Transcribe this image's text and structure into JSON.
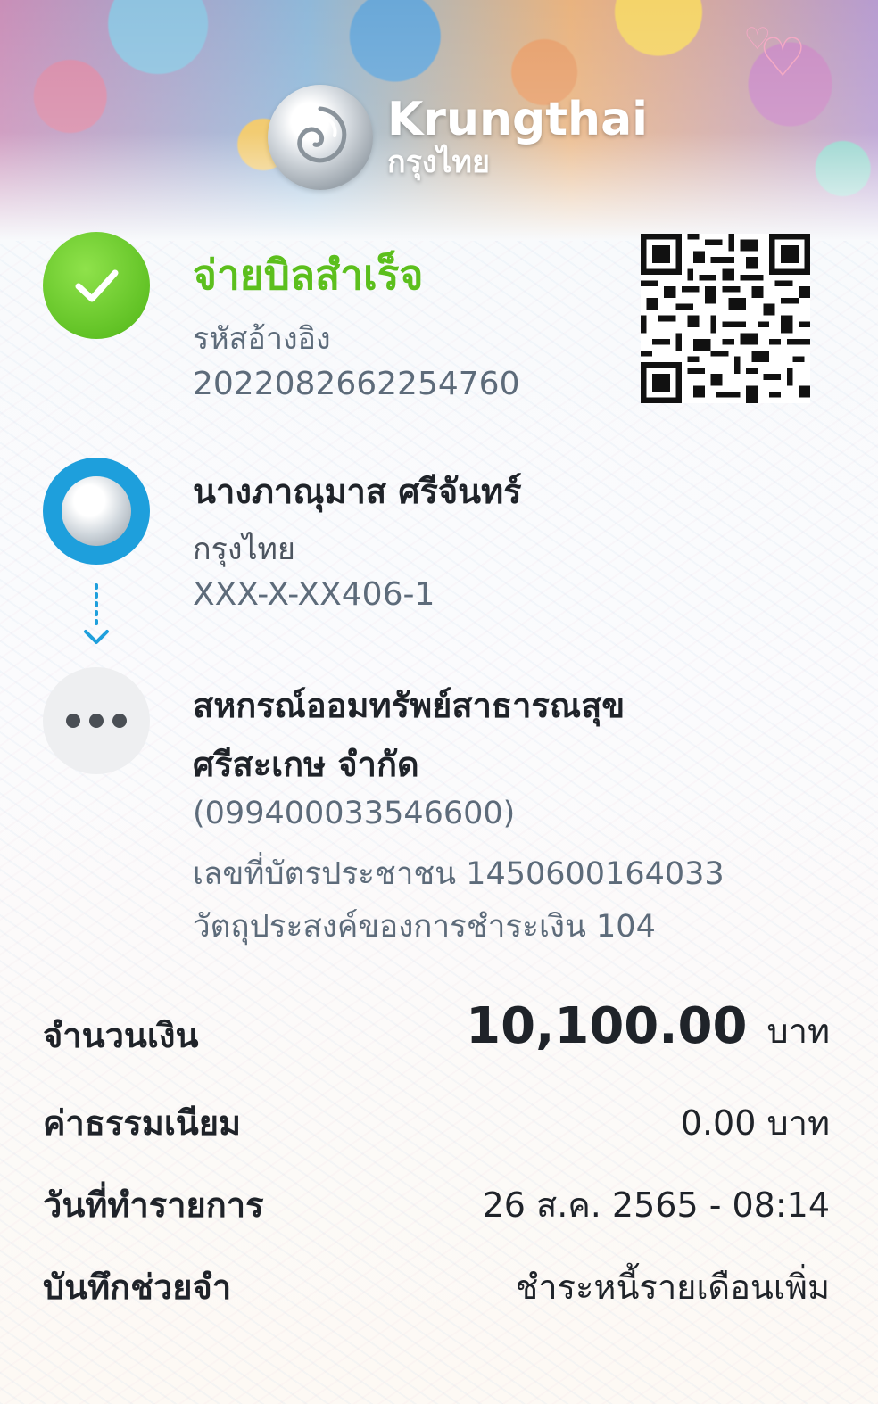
{
  "brand": {
    "name_en": "Krungthai",
    "name_th": "กรุงไทย"
  },
  "status": {
    "title": "จ่ายบิลสำเร็จ",
    "ref_label": "รหัสอ้างอิง",
    "ref_value": "2022082662254760",
    "color": "#5cbf1d",
    "icon": "check-icon"
  },
  "sender": {
    "name": "นางภาณุมาส ศรีจันทร์",
    "bank": "กรุงไทย",
    "account": "XXX-X-XX406-1",
    "icon_color": "#1e9fdc"
  },
  "receiver": {
    "name_line1": "สหกรณ์ออมทรัพย์สาธารณสุข",
    "name_line2": "ศรีสะเกษ จำกัด",
    "tax_id": "(099400033546600)",
    "ref1": "เลขที่บัตรประชาชน 1450600164033",
    "ref2": "วัตถุประสงค์ของการชำระเงิน 104"
  },
  "details": {
    "amount_label": "จำนวนเงิน",
    "amount_value": "10,100.00",
    "amount_unit": "บาท",
    "fee_label": "ค่าธรรมเนียม",
    "fee_value": "0.00 บาท",
    "date_label": "วันที่ทำรายการ",
    "date_value": "26 ส.ค. 2565 - 08:14",
    "memo_label": "บันทึกช่วยจำ",
    "memo_value": "ชำระหนี้รายเดือนเพิ่ม"
  }
}
